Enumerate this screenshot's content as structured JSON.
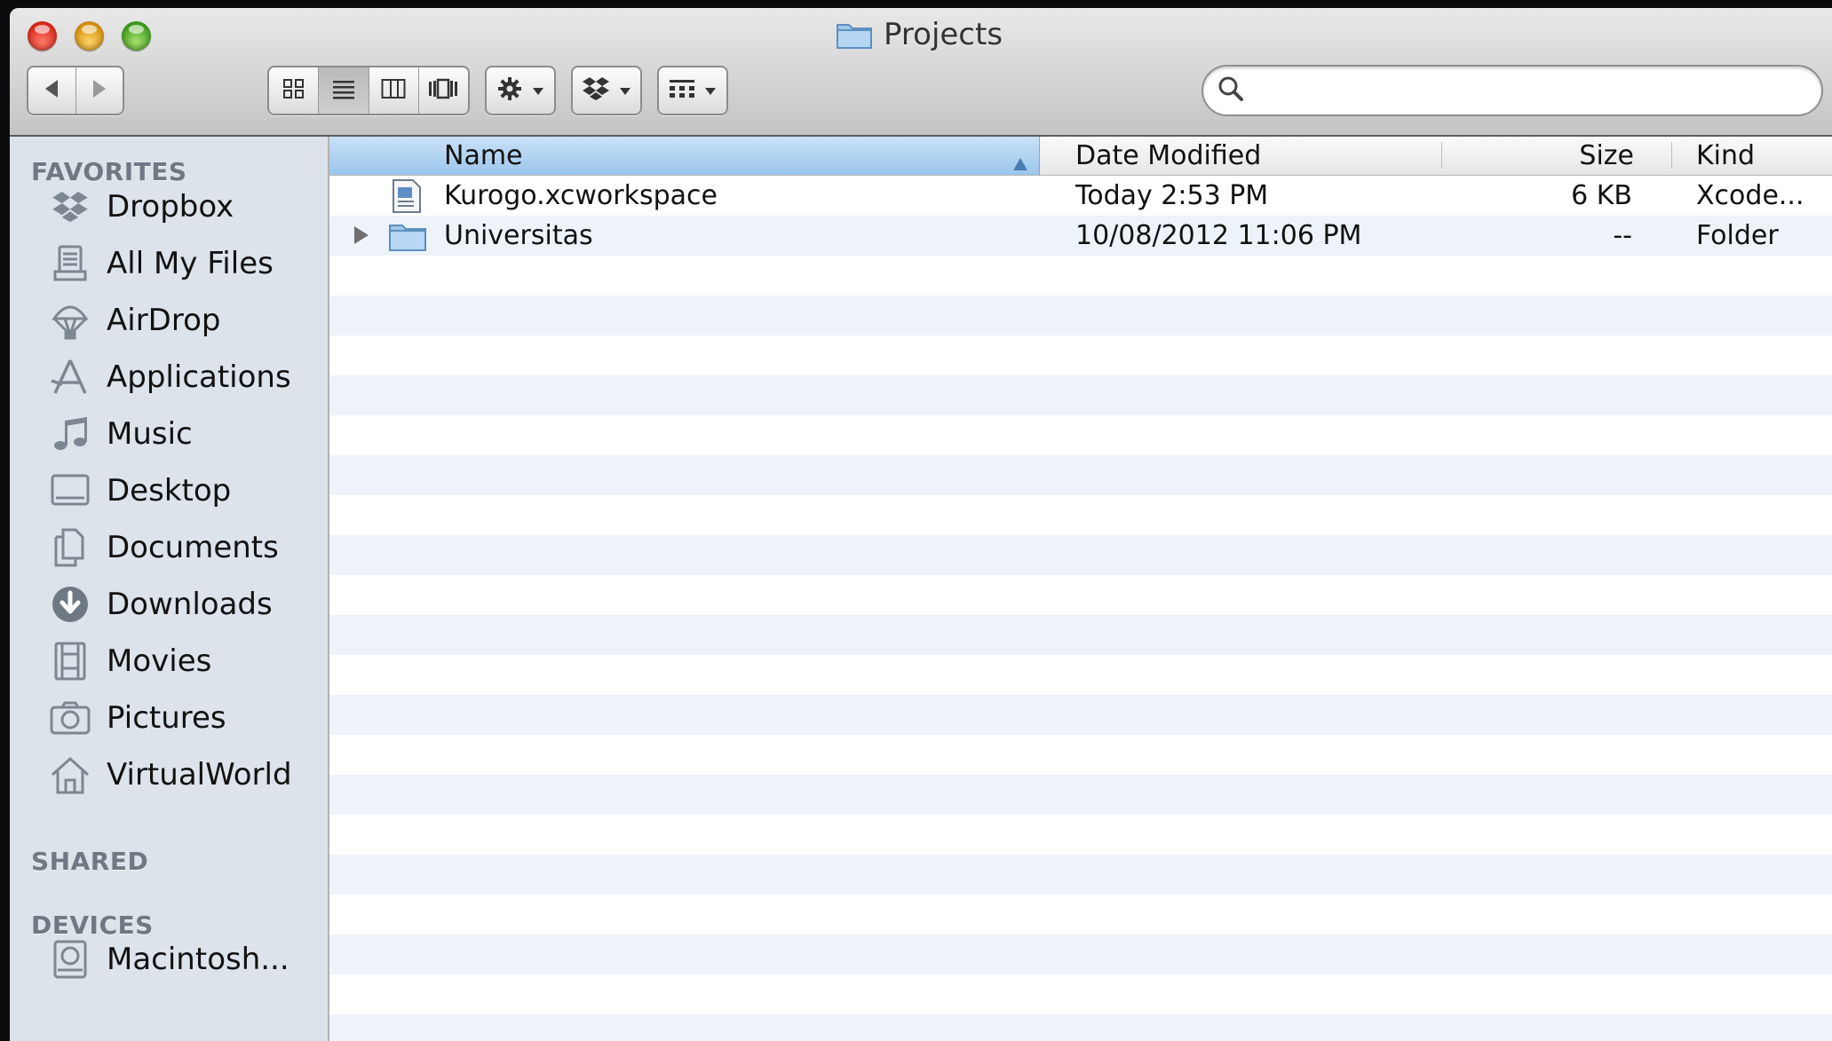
{
  "window": {
    "title": "Projects",
    "title_icon": "folder-icon"
  },
  "toolbar": {
    "nav": {
      "back_icon": "back-arrow-icon",
      "forward_icon": "forward-arrow-icon"
    },
    "view_modes": [
      {
        "name": "icon-view",
        "icon": "grid-icon",
        "active": false
      },
      {
        "name": "list-view",
        "icon": "list-icon",
        "active": true
      },
      {
        "name": "column-view",
        "icon": "columns-icon",
        "active": false
      },
      {
        "name": "coverflow-view",
        "icon": "coverflow-icon",
        "active": false
      }
    ],
    "action_icon": "gear-icon",
    "dropbox_icon": "dropbox-icon",
    "arrange_icon": "arrange-icon",
    "search": {
      "placeholder": "",
      "value": ""
    }
  },
  "sidebar": {
    "sections": {
      "favorites": "FAVORITES",
      "shared": "SHARED",
      "devices": "DEVICES"
    },
    "favorites": [
      {
        "label": "Dropbox",
        "icon": "dropbox-icon"
      },
      {
        "label": "All My Files",
        "icon": "all-files-icon"
      },
      {
        "label": "AirDrop",
        "icon": "airdrop-icon"
      },
      {
        "label": "Applications",
        "icon": "applications-icon"
      },
      {
        "label": "Music",
        "icon": "music-icon"
      },
      {
        "label": "Desktop",
        "icon": "desktop-icon"
      },
      {
        "label": "Documents",
        "icon": "documents-icon"
      },
      {
        "label": "Downloads",
        "icon": "downloads-icon"
      },
      {
        "label": "Movies",
        "icon": "movies-icon"
      },
      {
        "label": "Pictures",
        "icon": "pictures-icon"
      },
      {
        "label": "VirtualWorld",
        "icon": "home-icon"
      }
    ],
    "devices": [
      {
        "label": "Macintosh...",
        "icon": "hard-drive-icon"
      }
    ]
  },
  "list": {
    "columns": {
      "name": "Name",
      "date": "Date Modified",
      "size": "Size",
      "kind": "Kind"
    },
    "sort_column": "name",
    "sort_direction": "ascending",
    "rows": [
      {
        "name": "Kurogo.xcworkspace",
        "date": "Today 2:53 PM",
        "size": "6 KB",
        "kind": "Xcode...",
        "icon": "xcode-workspace-icon",
        "expandable": false
      },
      {
        "name": "Universitas",
        "date": "10/08/2012 11:06 PM",
        "size": "--",
        "kind": "Folder",
        "icon": "folder-icon",
        "expandable": true
      }
    ]
  },
  "colors": {
    "sidebar_bg": "#dde3ea",
    "stripe_alt": "#eef3fa",
    "sorted_header": "#9cc6ec",
    "section_header": "#6f7883"
  }
}
